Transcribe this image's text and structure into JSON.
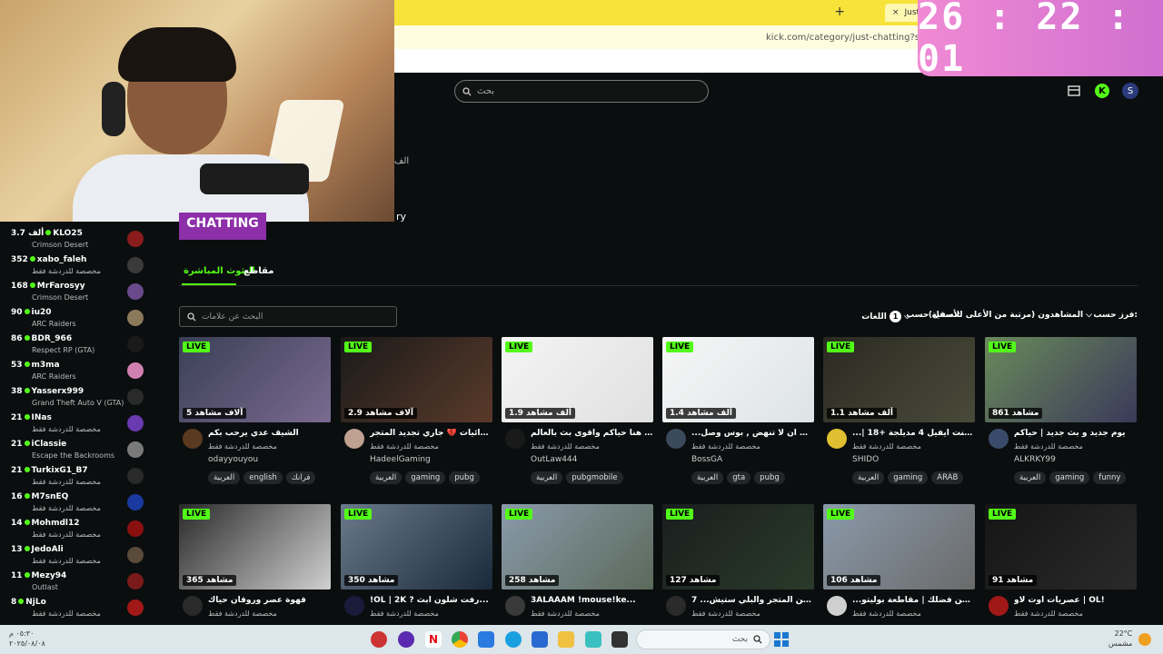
{
  "timer": "26 : 22 : 01",
  "browser": {
    "tab_title": "Just Chatti",
    "url": "kick.com/category/just-chatting?s",
    "new_tab": "+",
    "close_tab": "×"
  },
  "header": {
    "search_placeholder": "بحث"
  },
  "banner": {
    "chatting": "CHATTING",
    "ry": "ry",
    "side_glyph": "الف"
  },
  "sidebar": {
    "items": [
      {
        "count": "3.7 ألف",
        "name": "KLO25",
        "category": "Crimson Desert",
        "avatar_color": "#8a1c1c"
      },
      {
        "count": "352",
        "name": "xabo_faleh",
        "category": "مخصصة للدردشة فقط",
        "avatar_color": "#3a3a3a"
      },
      {
        "count": "168",
        "name": "MrFarosyy",
        "category": "Crimson Desert",
        "avatar_color": "#6a4a8a"
      },
      {
        "count": "90",
        "name": "iu20",
        "category": "ARC Raiders",
        "avatar_color": "#8a7a5a"
      },
      {
        "count": "86",
        "name": "BDR_966",
        "category": "Respect RP (GTA)",
        "avatar_color": "#1a1a1a"
      },
      {
        "count": "53",
        "name": "m3ma",
        "category": "ARC Raiders",
        "avatar_color": "#d080b0"
      },
      {
        "count": "38",
        "name": "Yasserx999",
        "category": "Grand Theft Auto V (GTA)",
        "avatar_color": "#2a2a2a"
      },
      {
        "count": "21",
        "name": "INas",
        "category": "مخصصة للدردشة فقط",
        "avatar_color": "#6a3ab0"
      },
      {
        "count": "21",
        "name": "iClassie",
        "category": "Escape the Backrooms",
        "avatar_color": "#7a7a7a"
      },
      {
        "count": "21",
        "name": "TurkixG1_B7",
        "category": "مخصصة للدردشة فقط",
        "avatar_color": "#2a2a2a"
      },
      {
        "count": "16",
        "name": "M7snEQ",
        "category": "مخصصة للدردشة فقط",
        "avatar_color": "#1a3aa0"
      },
      {
        "count": "14",
        "name": "Mohmdl12",
        "category": "مخصصة للدردشة فقط",
        "avatar_color": "#8a1010"
      },
      {
        "count": "13",
        "name": "JedoAli",
        "category": "مخصصة للدردشة فقط",
        "avatar_color": "#5a4a3a"
      },
      {
        "count": "11",
        "name": "Mezy94",
        "category": "Outlast",
        "avatar_color": "#7a1a1a"
      },
      {
        "count": "8",
        "name": "NjLo",
        "category": "مخصصة للدردشة فقط",
        "avatar_color": "#a01818"
      }
    ]
  },
  "tabs": {
    "live": "البثوث المباشرة",
    "clips": "مقاطع"
  },
  "tag_search": {
    "placeholder": "البحث عن علامات"
  },
  "filters": {
    "sort_label": "فرز حسب:",
    "sort_value": "المشاهدون (مرتبة من الأعلى للأسفل)",
    "filter_label": "تصفية حسب:",
    "lang_label": "اللغات",
    "lang_count": "1"
  },
  "live_label": "LIVE",
  "cards": [
    {
      "viewers": "5 آلاف مشاهد",
      "title": "الشيف عدي يرحب بكم",
      "category": "مخصصة للدردشة فقط",
      "user": "odayyouyou",
      "tags": [
        "العربية",
        "english",
        "فرانك"
      ],
      "thumb": [
        "#3a3f55",
        "#7a6a90"
      ],
      "avatar": "#5a3a20"
    },
    {
      "viewers": "2.9 آلاف مشاهد",
      "title": "عشوائيات 💔 جاري تجديد المتجر",
      "category": "مخصصة للدردشة فقط",
      "user": "HadeelGaming",
      "tags": [
        "العربية",
        "gaming",
        "pubg"
      ],
      "thumb": [
        "#1a1a1a",
        "#5a3a2a"
      ],
      "avatar": "#c0a090"
    },
    {
      "viewers": "1.9 ألف مشاهد",
      "title": "الاوائل هنا حياكم واقوى بث بالعالم",
      "category": "مخصصة للدردشة فقط",
      "user": "OutLaw444",
      "tags": [
        "العربية",
        "pubgmobile"
      ],
      "thumb": [
        "#f4f4f4",
        "#e0e0e0"
      ],
      "avatar": "#1a1a1a"
    },
    {
      "viewers": "1.4 ألف مشاهد",
      "title": "...ا من ان لا تنهض , بوس وصل",
      "category": "مخصصة للدردشة فقط",
      "user": "BossGA",
      "tags": [
        "العربية",
        "gta",
        "pubg"
      ],
      "thumb": [
        "#f6f6f6",
        "#dde3e6"
      ],
      "avatar": "#3a4a5a"
    },
    {
      "viewers": "1.1 ألف مشاهد",
      "title": "...| 18+ رزدينت ايفيل 4 مديلجة",
      "category": "مخصصة للدردشة فقط",
      "user": "SHIDO",
      "tags": [
        "العربية",
        "gaming",
        "ARAB"
      ],
      "thumb": [
        "#2a2a22",
        "#4a4a3a"
      ],
      "avatar": "#e0c030"
    },
    {
      "viewers": "861 مشاهد",
      "title": "يوم جديد و بث جديد | حياكم",
      "category": "مخصصة للدردشة فقط",
      "user": "ALKRKY99",
      "tags": [
        "العربية",
        "gaming",
        "funny"
      ],
      "thumb": [
        "#6a8a5a",
        "#3a3a5a"
      ],
      "avatar": "#3a4a6a"
    },
    {
      "viewers": "365 مشاهد",
      "title": "قهوة عصر وروقان حياك",
      "category": "مخصصة للدردشة فقط",
      "user": "",
      "tags": [],
      "thumb": [
        "#2a2a2a",
        "#d0d0d0"
      ],
      "avatar": "#2a2a2a"
    },
    {
      "viewers": "350 مشاهد",
      "title": "!OL | 2K ? رفت شلون ابث...",
      "category": "مخصصة للدردشة فقط",
      "user": "",
      "tags": [],
      "thumb": [
        "#6a7a8a",
        "#1a2a3a"
      ],
      "avatar": "#1a1a3a"
    },
    {
      "viewers": "258 مشاهد",
      "title": "3ALAAAM !mouse!ke...",
      "category": "مخصصة للدردشة فقط",
      "user": "",
      "tags": [],
      "thumb": [
        "#8a9aaa",
        "#5a6a5a"
      ],
      "avatar": "#3a3a3a"
    },
    {
      "viewers": "127 مشاهد",
      "title": "7 ...ن عن المتجر والبلي ستيش",
      "category": "مخصصة للدردشة فقط",
      "user": "",
      "tags": [],
      "thumb": [
        "#1a1e1e",
        "#2a3a2a"
      ],
      "avatar": "#2a2a2a"
    },
    {
      "viewers": "106 مشاهد",
      "title": "...ويلاه من فضلك | مقاطعة بوليتو",
      "category": "مخصصة للدردشة فقط",
      "user": "",
      "tags": [],
      "thumb": [
        "#8a9aaa",
        "#6a6a6a"
      ],
      "avatar": "#cfcfcf"
    },
    {
      "viewers": "91 مشاهد",
      "title": "عصريات اوت لاو | OL!",
      "category": "مخصصة للدردشة فقط",
      "user": "",
      "tags": [],
      "thumb": [
        "#151515",
        "#2a2a2a"
      ],
      "avatar": "#a01818"
    }
  ],
  "taskbar": {
    "search_text": "بحث",
    "time": "٠٥:٣٠ م",
    "date": "٢٠٢٥/٠٨/٠٨",
    "temp": "22°C",
    "weather": "مشمس"
  },
  "colors": {
    "accent": "#53fc18",
    "timer_bg": "#e07ed4",
    "page_bg": "#0b0e0f"
  }
}
